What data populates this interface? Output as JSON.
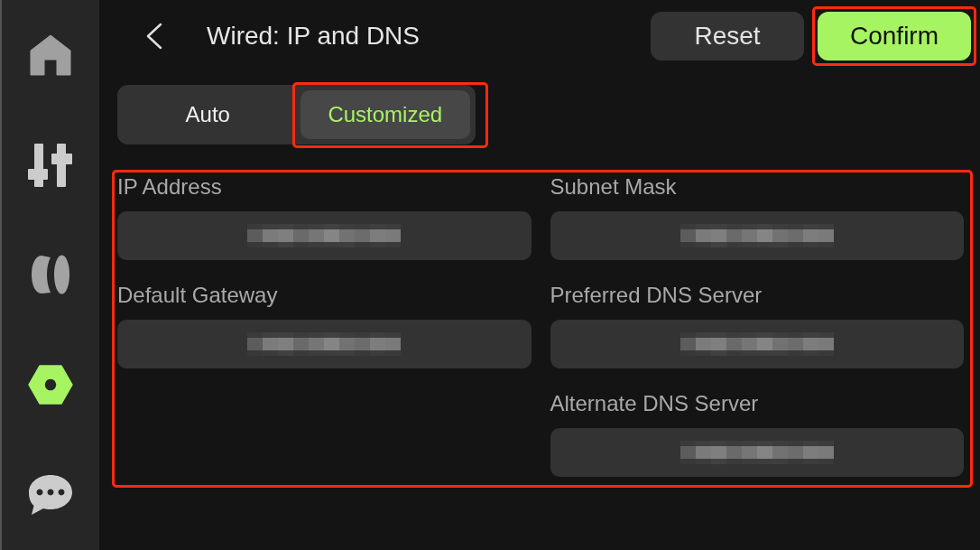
{
  "sidebar": {
    "items": [
      {
        "kind": "home",
        "selected": false
      },
      {
        "kind": "sliders",
        "selected": false
      },
      {
        "kind": "spool",
        "selected": false
      },
      {
        "kind": "nut",
        "selected": true
      },
      {
        "kind": "chat",
        "selected": false
      }
    ]
  },
  "header": {
    "title": "Wired: IP and DNS",
    "buttons": [
      {
        "label": "Reset",
        "kind": "secondary",
        "highlighted": false
      },
      {
        "label": "Confirm",
        "kind": "primary",
        "highlighted": true
      }
    ]
  },
  "mode_tabs": {
    "items": [
      {
        "label": "Auto",
        "selected": false,
        "highlighted": false
      },
      {
        "label": "Customized",
        "selected": true,
        "highlighted": true
      }
    ]
  },
  "form": {
    "highlighted": true,
    "columns": [
      {
        "fields": [
          {
            "label": "IP Address",
            "value_obscured": true
          },
          {
            "label": "Default Gateway",
            "value_obscured": true
          }
        ]
      },
      {
        "fields": [
          {
            "label": "Subnet Mask",
            "value_obscured": true
          },
          {
            "label": "Preferred DNS Server",
            "value_obscured": true
          },
          {
            "label": "Alternate DNS Server",
            "value_obscured": true
          }
        ]
      }
    ]
  }
}
